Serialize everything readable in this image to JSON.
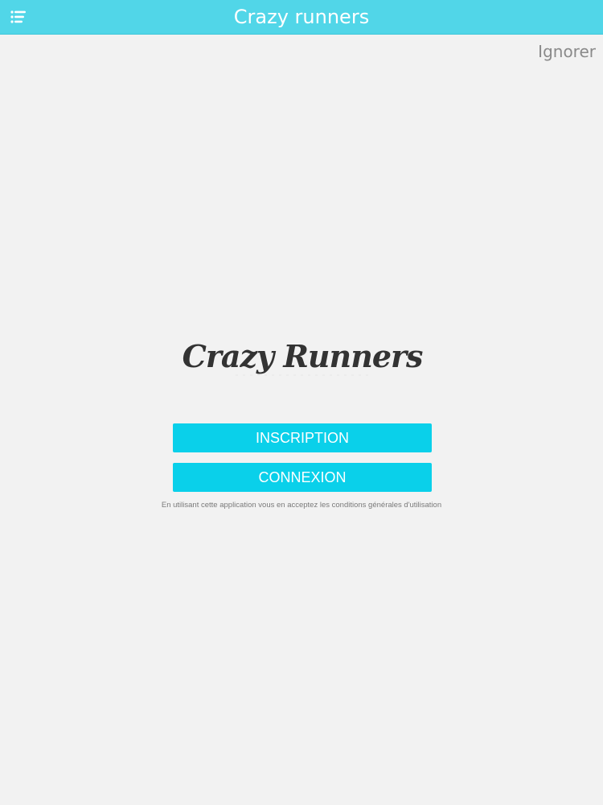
{
  "navbar": {
    "title": "Crazy runners",
    "menu_icon": "menu-list-icon",
    "color": "#51d6e8"
  },
  "skip": {
    "label": "Ignorer"
  },
  "logo": {
    "text": "Crazy Runners"
  },
  "actions": {
    "signup_label": "INSCRIPTION",
    "login_label": "CONNEXION",
    "button_color": "#0ad0ea"
  },
  "terms": {
    "text": "En utilisant cette application vous en acceptez les conditions générales d'utilisation"
  }
}
